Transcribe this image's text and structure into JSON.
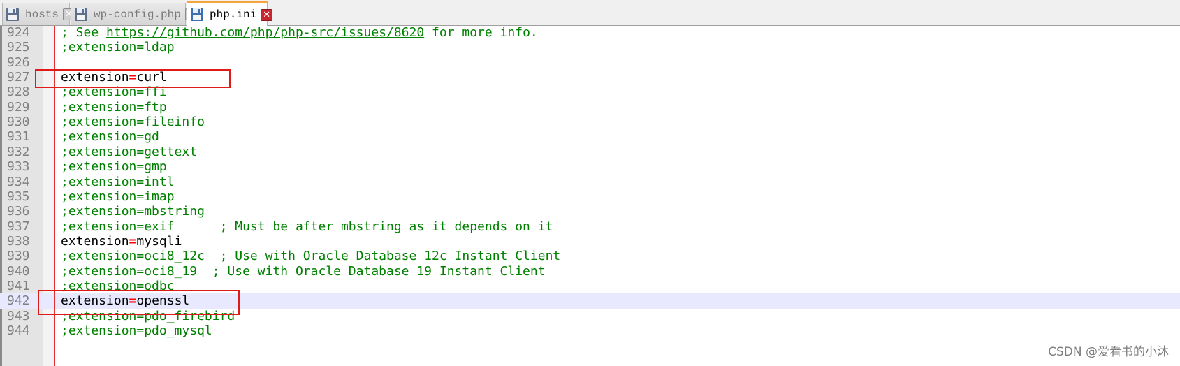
{
  "tabs": [
    {
      "label": "hosts",
      "active": false,
      "icon": "floppy-disk-icon"
    },
    {
      "label": "wp-config.php",
      "active": false,
      "icon": "floppy-disk-icon"
    },
    {
      "label": "php.ini",
      "active": true,
      "icon": "floppy-disk-icon"
    }
  ],
  "close_glyph": "✕",
  "lines": [
    {
      "num": "924",
      "segments": [
        {
          "t": "; See ",
          "c": "cmt"
        },
        {
          "t": "https://github.com/php/php-src/issues/8620",
          "c": "url"
        },
        {
          "t": " for more info.",
          "c": "cmt"
        }
      ]
    },
    {
      "num": "925",
      "segments": [
        {
          "t": ";extension=ldap",
          "c": "cmt"
        }
      ]
    },
    {
      "num": "926",
      "segments": []
    },
    {
      "num": "927",
      "segments": [
        {
          "t": "extension",
          "c": "key"
        },
        {
          "t": "=",
          "c": "eq"
        },
        {
          "t": "curl",
          "c": "val"
        }
      ]
    },
    {
      "num": "928",
      "segments": [
        {
          "t": ";extension=ffi",
          "c": "cmt"
        }
      ]
    },
    {
      "num": "929",
      "segments": [
        {
          "t": ";extension=ftp",
          "c": "cmt"
        }
      ]
    },
    {
      "num": "930",
      "segments": [
        {
          "t": ";extension=fileinfo",
          "c": "cmt"
        }
      ]
    },
    {
      "num": "931",
      "segments": [
        {
          "t": ";extension=gd",
          "c": "cmt"
        }
      ]
    },
    {
      "num": "932",
      "segments": [
        {
          "t": ";extension=gettext",
          "c": "cmt"
        }
      ]
    },
    {
      "num": "933",
      "segments": [
        {
          "t": ";extension=gmp",
          "c": "cmt"
        }
      ]
    },
    {
      "num": "934",
      "segments": [
        {
          "t": ";extension=intl",
          "c": "cmt"
        }
      ]
    },
    {
      "num": "935",
      "segments": [
        {
          "t": ";extension=imap",
          "c": "cmt"
        }
      ]
    },
    {
      "num": "936",
      "segments": [
        {
          "t": ";extension=mbstring",
          "c": "cmt"
        }
      ]
    },
    {
      "num": "937",
      "segments": [
        {
          "t": ";extension=exif      ; Must be after mbstring as it depends on it",
          "c": "cmt"
        }
      ]
    },
    {
      "num": "938",
      "segments": [
        {
          "t": "extension",
          "c": "key"
        },
        {
          "t": "=",
          "c": "eq"
        },
        {
          "t": "mysqli",
          "c": "val"
        }
      ]
    },
    {
      "num": "939",
      "segments": [
        {
          "t": ";extension=oci8_12c  ; Use with Oracle Database 12c Instant Client",
          "c": "cmt"
        }
      ]
    },
    {
      "num": "940",
      "segments": [
        {
          "t": ";extension=oci8_19  ; Use with Oracle Database 19 Instant Client",
          "c": "cmt"
        }
      ]
    },
    {
      "num": "941",
      "segments": [
        {
          "t": ";extension=odbc",
          "c": "cmt"
        }
      ]
    },
    {
      "num": "942",
      "current": true,
      "segments": [
        {
          "t": "extension",
          "c": "key"
        },
        {
          "t": "=",
          "c": "eq"
        },
        {
          "t": "openssl",
          "c": "val"
        }
      ]
    },
    {
      "num": "943",
      "segments": [
        {
          "t": ";extension=pdo_firebird",
          "c": "cmt"
        }
      ]
    },
    {
      "num": "944",
      "segments": [
        {
          "t": ";extension=pdo_mysql",
          "c": "cmt"
        }
      ]
    }
  ],
  "watermark": "CSDN @爱看书的小沐",
  "colors": {
    "comment": "#008000",
    "operator": "#ff0000",
    "annotation_box": "#e01919",
    "active_tab_accent": "#f6a33b"
  }
}
